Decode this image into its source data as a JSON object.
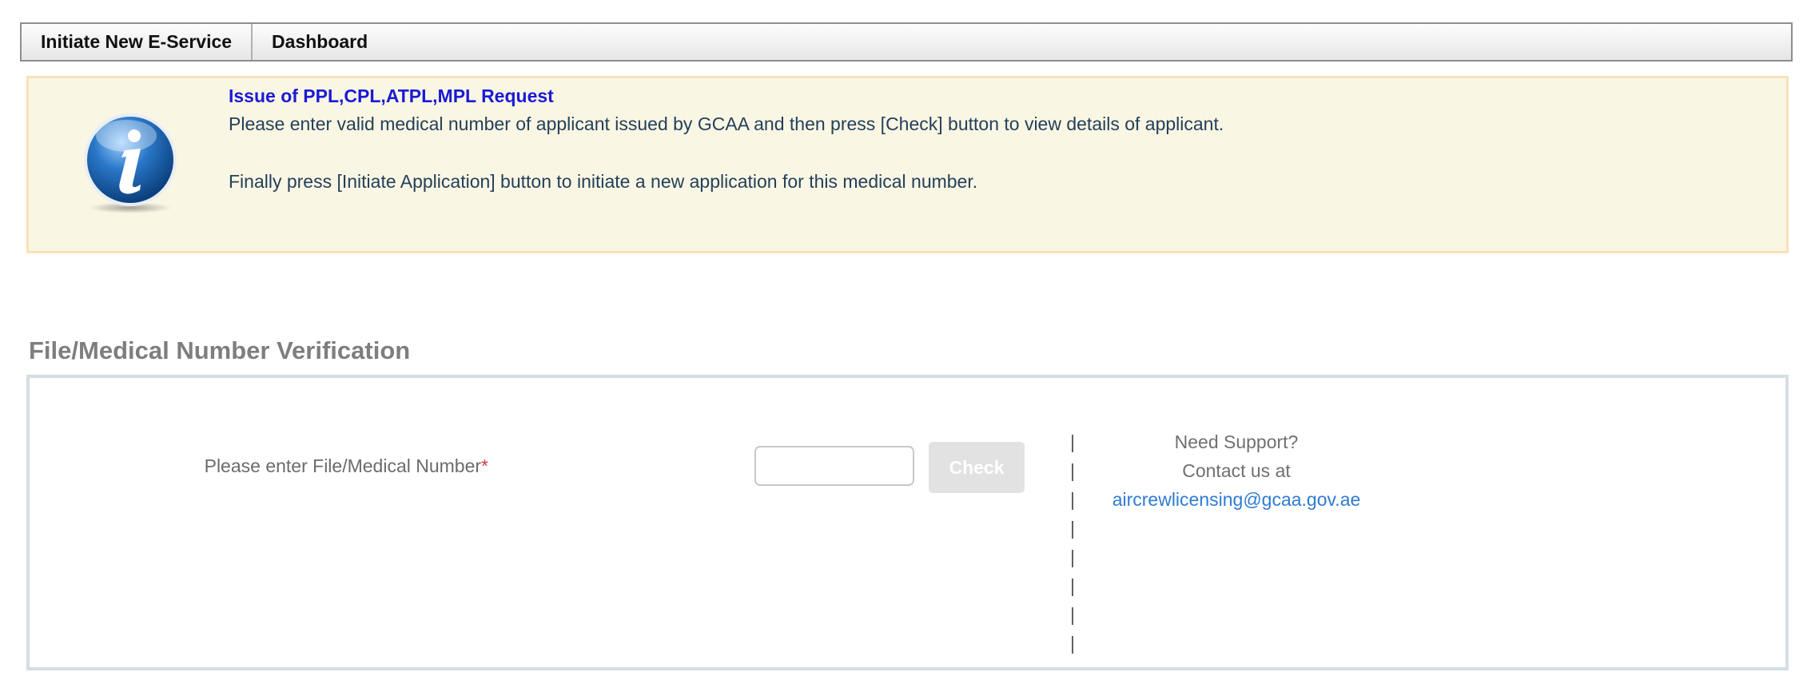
{
  "tabs": [
    {
      "label": "Initiate New E-Service"
    },
    {
      "label": "Dashboard"
    }
  ],
  "info": {
    "icon": "info-icon",
    "title": "Issue of PPL,CPL,ATPL,MPL Request",
    "line1": "Please enter valid medical number of applicant issued by GCAA and then press [Check] button to view details of applicant.",
    "line2": "Finally press [Initiate Application] button to initiate a new application for this medical number."
  },
  "section": {
    "title": "File/Medical Number Verification"
  },
  "form": {
    "label": "Please enter File/Medical Number",
    "required_mark": "*",
    "input_value": "",
    "check_label": "Check"
  },
  "divider": [
    "|",
    "|",
    "|",
    "|",
    "|",
    "|",
    "|",
    "|"
  ],
  "support": {
    "line1": "Need Support?",
    "line2": "Contact us at",
    "email": "aircrewlicensing@gcaa.gov.ae"
  },
  "colors": {
    "title_blue": "#1a1ad6",
    "info_bg": "#faf6e4",
    "link_blue": "#2f7bd3",
    "required_red": "#d43a3a"
  }
}
